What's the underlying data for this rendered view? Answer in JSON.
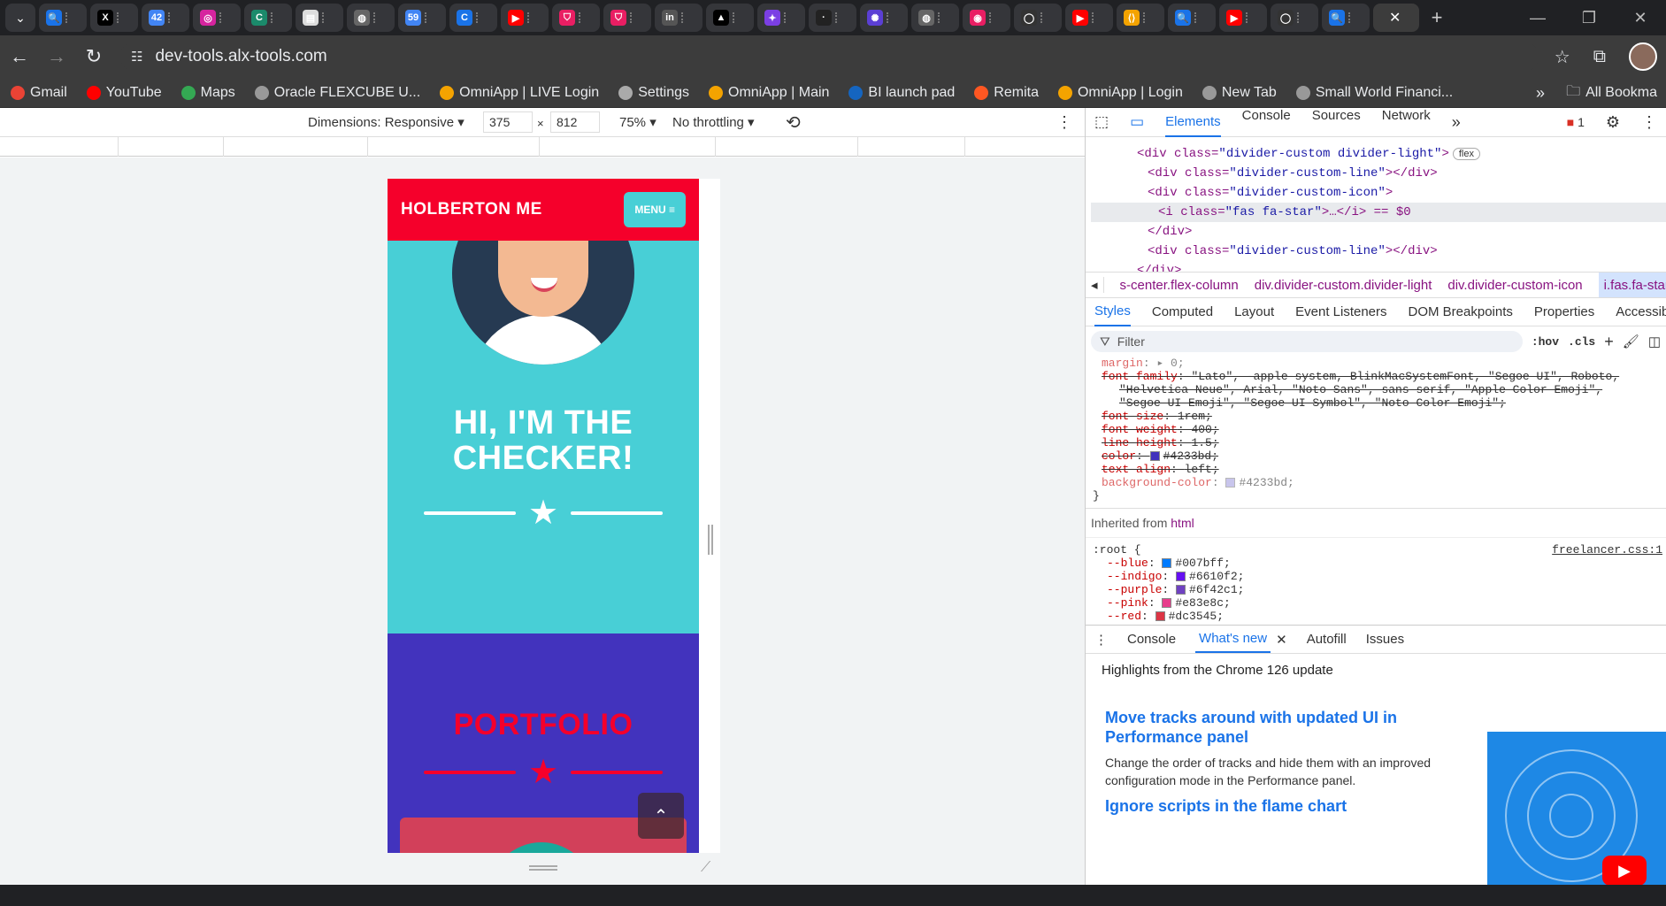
{
  "browser": {
    "url": "dev-tools.alx-tools.com",
    "tabs": [
      {
        "icon": "search-icon",
        "color": "#1a73e8",
        "glyph": "🔍"
      },
      {
        "icon": "x-icon",
        "color": "#000",
        "glyph": "X"
      },
      {
        "icon": "chrome-icon",
        "color": "#4285f4",
        "glyph": "42"
      },
      {
        "icon": "instagram-icon",
        "color": "#d6249f",
        "glyph": "◎"
      },
      {
        "icon": "c-icon",
        "color": "#1b8a6b",
        "glyph": "C"
      },
      {
        "icon": "doc-icon",
        "color": "#ddd",
        "glyph": "▤"
      },
      {
        "icon": "globe-icon",
        "color": "#666",
        "glyph": "◍"
      },
      {
        "icon": "chrome-59-icon",
        "color": "#4285f4",
        "glyph": "59"
      },
      {
        "icon": "c-blue-icon",
        "color": "#1a73e8",
        "glyph": "C"
      },
      {
        "icon": "youtube-icon",
        "color": "#f00",
        "glyph": "▶"
      },
      {
        "icon": "shield-icon",
        "color": "#e91e63",
        "glyph": "⛉"
      },
      {
        "icon": "shield-icon",
        "color": "#e91e63",
        "glyph": "⛉"
      },
      {
        "icon": "linkedin-icon",
        "color": "#555",
        "glyph": "in"
      },
      {
        "icon": "triangle-icon",
        "color": "#000",
        "glyph": "▲"
      },
      {
        "icon": "app-icon",
        "color": "#7b3fe4",
        "glyph": "✦"
      },
      {
        "icon": "dark-icon",
        "color": "#222",
        "glyph": "·"
      },
      {
        "icon": "spark-icon",
        "color": "#5b3fd4",
        "glyph": "✺"
      },
      {
        "icon": "globe-icon",
        "color": "#666",
        "glyph": "◍"
      },
      {
        "icon": "pink-icon",
        "color": "#e91e63",
        "glyph": "◉"
      },
      {
        "icon": "github-icon",
        "color": "#333",
        "glyph": "◯"
      },
      {
        "icon": "youtube-icon",
        "color": "#f00",
        "glyph": "▶"
      },
      {
        "icon": "code-icon",
        "color": "#f4a300",
        "glyph": "⟨⟩"
      },
      {
        "icon": "search-icon",
        "color": "#1a73e8",
        "glyph": "🔍"
      },
      {
        "icon": "youtube-icon",
        "color": "#f00",
        "glyph": "▶"
      },
      {
        "icon": "github-icon",
        "color": "#333",
        "glyph": "◯"
      },
      {
        "icon": "search-icon",
        "color": "#1a73e8",
        "glyph": "🔍"
      }
    ],
    "bookmarks": [
      {
        "label": "Gmail",
        "color": "#ea4335"
      },
      {
        "label": "YouTube",
        "color": "#f00"
      },
      {
        "label": "Maps",
        "color": "#34a853"
      },
      {
        "label": "Oracle FLEXCUBE U...",
        "color": "#999"
      },
      {
        "label": "OmniApp | LIVE Login",
        "color": "#f4a300"
      },
      {
        "label": "Settings",
        "color": "#aaa"
      },
      {
        "label": "OmniApp | Main",
        "color": "#f4a300"
      },
      {
        "label": "BI launch pad",
        "color": "#1565c0"
      },
      {
        "label": "Remita",
        "color": "#ff5722"
      },
      {
        "label": "OmniApp | Login",
        "color": "#f4a300"
      },
      {
        "label": "New Tab",
        "color": "#999"
      },
      {
        "label": "Small World Financi...",
        "color": "#999"
      }
    ],
    "all_bookmarks": "All Bookma"
  },
  "device_toolbar": {
    "dimensions_label": "Dimensions: Responsive ▾",
    "width": "375",
    "times": "×",
    "height": "812",
    "zoom": "75% ▾",
    "throttle": "No throttling ▾"
  },
  "page": {
    "brand": "HOLBERTON ME",
    "menu": "MENU ≡",
    "hero_title_line1": "HI, I'M THE",
    "hero_title_line2": "CHECKER!",
    "portfolio": "PORTFOLIO",
    "star": "★",
    "colors": {
      "primary": "#f5002b",
      "hero_bg": "#48cfd6",
      "portfolio_bg": "#4233bd"
    }
  },
  "devtools": {
    "tabs": [
      "Elements",
      "Console",
      "Sources",
      "Network"
    ],
    "error_count": "1",
    "dom_lines": [
      {
        "indent": 1,
        "text_tag": "<div class=",
        "attr": "\"divider-custom divider-light\"",
        "tail": ">",
        "badge": "flex"
      },
      {
        "indent": 2,
        "text_tag": "<div class=",
        "attr": "\"divider-custom-line\"",
        "tail": "></div>",
        "badge": ""
      },
      {
        "indent": 2,
        "text_tag": "<div class=",
        "attr": "\"divider-custom-icon\"",
        "tail": ">",
        "badge": ""
      },
      {
        "indent": 3,
        "text_tag": "<i class=",
        "attr": "\"fas fa-star\"",
        "tail": ">…</i> == $0",
        "badge": ""
      },
      {
        "indent": 2,
        "text_tag": "</div>",
        "attr": "",
        "tail": "",
        "badge": ""
      },
      {
        "indent": 2,
        "text_tag": "<div class=",
        "attr": "\"divider-custom-line\"",
        "tail": "></div>",
        "badge": ""
      },
      {
        "indent": 1,
        "text_tag": "</div>",
        "attr": "",
        "tail": "",
        "badge": ""
      }
    ],
    "crumbs": [
      "s-center.flex-column",
      "div.divider-custom.divider-light",
      "div.divider-custom-icon",
      "i.fas.fa-star"
    ],
    "subtabs": [
      "Styles",
      "Computed",
      "Layout",
      "Event Listeners",
      "DOM Breakpoints",
      "Properties",
      "Accessibi"
    ],
    "filter_placeholder": "Filter",
    "hov": ":hov",
    "cls": ".cls",
    "css_rules": [
      {
        "prop": "margin",
        "val": "▸ 0;",
        "strike": false,
        "sw": ""
      },
      {
        "prop": "font-family",
        "val": "\"Lato\", -apple-system, BlinkMacSystemFont, \"Segoe UI\", Roboto,",
        "strike": true,
        "sw": ""
      },
      {
        "prop": "",
        "val": "\"Helvetica Neue\", Arial, \"Noto Sans\", sans-serif, \"Apple Color Emoji\",",
        "strike": true,
        "sw": ""
      },
      {
        "prop": "",
        "val": "\"Segoe UI Emoji\", \"Segoe UI Symbol\", \"Noto Color Emoji\";",
        "strike": true,
        "sw": ""
      },
      {
        "prop": "font-size",
        "val": "1rem;",
        "strike": true,
        "sw": ""
      },
      {
        "prop": "font-weight",
        "val": "400;",
        "strike": true,
        "sw": ""
      },
      {
        "prop": "line-height",
        "val": "1.5;",
        "strike": true,
        "sw": ""
      },
      {
        "prop": "color",
        "val": "#4233bd;",
        "strike": true,
        "sw": "#4233bd"
      },
      {
        "prop": "text-align",
        "val": "left;",
        "strike": true,
        "sw": ""
      },
      {
        "prop": "background-color",
        "val": "#4233bd;",
        "strike": false,
        "sw": "#a59fe0"
      }
    ],
    "inherited_label": "Inherited from",
    "inherited_tag": "html",
    "root_selector": ":root {",
    "root_source": "freelancer.css:1",
    "root_vars": [
      {
        "name": "--blue",
        "val": "#007bff;",
        "color": "#007bff"
      },
      {
        "name": "--indigo",
        "val": "#6610f2;",
        "color": "#6610f2"
      },
      {
        "name": "--purple",
        "val": "#6f42c1;",
        "color": "#6f42c1"
      },
      {
        "name": "--pink",
        "val": "#e83e8c;",
        "color": "#e83e8c"
      },
      {
        "name": "--red",
        "val": "#dc3545;",
        "color": "#dc3545"
      }
    ],
    "drawer_tabs": [
      "Console",
      "What's new",
      "Autofill",
      "Issues"
    ],
    "whats_new_head": "Highlights from the Chrome 126 update",
    "news": [
      {
        "title": "Move tracks around with updated UI in Performance panel",
        "body": "Change the order of tracks and hide them with an improved configuration mode in the Performance panel."
      },
      {
        "title": "Ignore scripts in the flame chart",
        "body": ""
      }
    ]
  }
}
